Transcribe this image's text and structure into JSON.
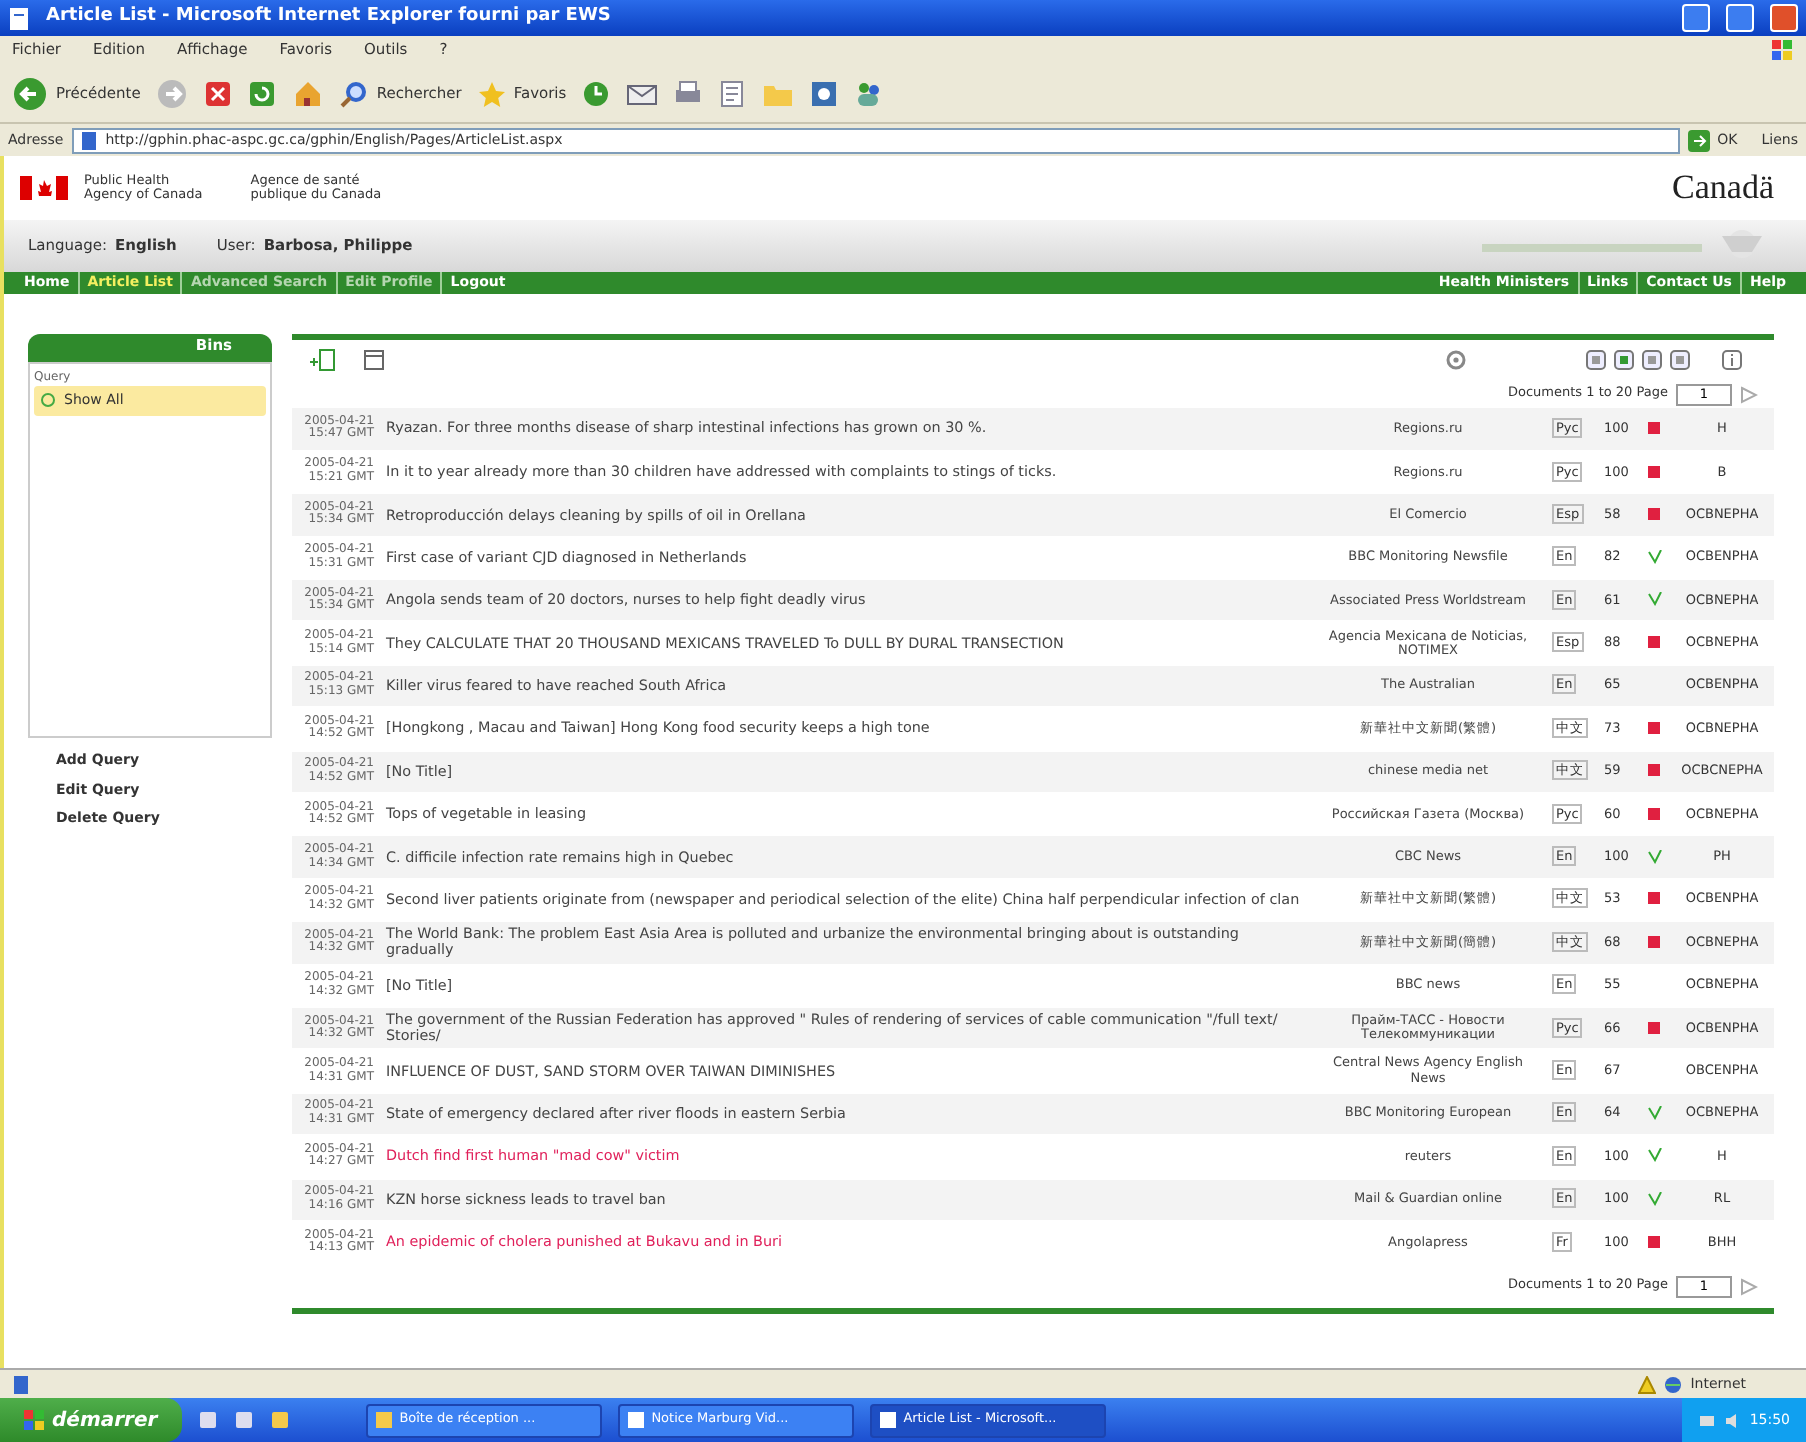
{
  "window": {
    "title": "Article List - Microsoft Internet Explorer fourni par EWS"
  },
  "menu": [
    "Fichier",
    "Edition",
    "Affichage",
    "Favoris",
    "Outils",
    "?"
  ],
  "toolbar": {
    "back": "Précédente",
    "search": "Rechercher",
    "favorites": "Favoris"
  },
  "address": {
    "label": "Adresse",
    "url": "http://gphin.phac-aspc.gc.ca/gphin/English/Pages/ArticleList.aspx",
    "go": "OK",
    "links": "Liens"
  },
  "agency": {
    "en_1": "Public Health",
    "en_2": "Agency of Canada",
    "fr_1": "Agence de santé",
    "fr_2": "publique du Canada",
    "wordmark": "Canadä"
  },
  "user_bar": {
    "language_label": "Language:",
    "language": "English",
    "user_label": "User:",
    "user": "Barbosa, Philippe"
  },
  "nav_left": [
    {
      "label": "Home",
      "selected": false
    },
    {
      "label": "Article List",
      "selected": true
    },
    {
      "label": "Advanced Search",
      "selected": false
    },
    {
      "label": "Edit Profile",
      "selected": false
    },
    {
      "label": "Logout",
      "selected": false
    }
  ],
  "nav_right": [
    "Health Ministers",
    "Links",
    "Contact Us",
    "Help"
  ],
  "sidebar": {
    "title": "Bins",
    "query_label": "Query",
    "items": [
      {
        "label": "Show All",
        "selected": true
      }
    ],
    "actions": [
      "Add Query",
      "Edit Query",
      "Delete Query"
    ]
  },
  "pager_top": {
    "label": "Documents 1 to 20 Page",
    "value": "1"
  },
  "rows": [
    {
      "date": "2005-04-21",
      "time": "15:47 GMT",
      "title": "Ryazan. For three months disease of sharp intestinal infections has grown on 30 %.",
      "flagged": false,
      "source": "Regions.ru",
      "lang": "Рус",
      "score": "100",
      "checked": false,
      "rejected": true,
      "code": "H"
    },
    {
      "date": "2005-04-21",
      "time": "15:21 GMT",
      "title": "In it to year already more than 30 children have addressed with complaints to stings of ticks.",
      "flagged": false,
      "source": "Regions.ru",
      "lang": "Рус",
      "score": "100",
      "checked": false,
      "rejected": true,
      "code": "B"
    },
    {
      "date": "2005-04-21",
      "time": "15:34 GMT",
      "title": "Retroproducción delays cleaning by spills of oil in Orellana",
      "flagged": false,
      "source": "El Comercio",
      "lang": "Esp",
      "score": "58",
      "checked": false,
      "rejected": true,
      "code": "OCBNEPHA"
    },
    {
      "date": "2005-04-21",
      "time": "15:31 GMT",
      "title": "First case of variant CJD diagnosed in Netherlands",
      "flagged": false,
      "source": "BBC Monitoring Newsfile",
      "lang": "En",
      "score": "82",
      "checked": true,
      "rejected": false,
      "code": "OCBENPHA"
    },
    {
      "date": "2005-04-21",
      "time": "15:34 GMT",
      "title": "Angola sends team of 20 doctors, nurses to help fight deadly virus",
      "flagged": false,
      "source": "Associated Press Worldstream",
      "lang": "En",
      "score": "61",
      "checked": true,
      "rejected": false,
      "code": "OCBNEPHA"
    },
    {
      "date": "2005-04-21",
      "time": "15:14 GMT",
      "title": "They CALCULATE THAT 20 THOUSAND MEXICANS TRAVELED To DULL BY DURAL TRANSECTION",
      "flagged": false,
      "source": "Agencia Mexicana de Noticias, NOTIMEX",
      "lang": "Esp",
      "score": "88",
      "checked": false,
      "rejected": true,
      "code": "OCBNEPHA"
    },
    {
      "date": "2005-04-21",
      "time": "15:13 GMT",
      "title": "Killer virus feared to have reached South Africa",
      "flagged": false,
      "source": "The Australian",
      "lang": "En",
      "score": "65",
      "checked": false,
      "rejected": false,
      "code": "OCBENPHA"
    },
    {
      "date": "2005-04-21",
      "time": "14:52 GMT",
      "title": "[Hongkong , Macau and Taiwan] Hong Kong food security keeps a high tone",
      "flagged": false,
      "source": "新華社中文新聞(繁體)",
      "lang": "中文",
      "score": "73",
      "checked": false,
      "rejected": true,
      "code": "OCBNEPHA"
    },
    {
      "date": "2005-04-21",
      "time": "14:52 GMT",
      "title": "[No Title]",
      "flagged": false,
      "source": "chinese media net",
      "lang": "中文",
      "score": "59",
      "checked": false,
      "rejected": true,
      "code": "OCBCNEPHA"
    },
    {
      "date": "2005-04-21",
      "time": "14:52 GMT",
      "title": "Tops of vegetable in leasing",
      "flagged": false,
      "source": "Российская Газета (Москва)",
      "lang": "Рус",
      "score": "60",
      "checked": false,
      "rejected": true,
      "code": "OCBNEPHA"
    },
    {
      "date": "2005-04-21",
      "time": "14:34 GMT",
      "title": "C. difficile infection rate remains high in Quebec",
      "flagged": false,
      "source": "CBC News",
      "lang": "En",
      "score": "100",
      "checked": true,
      "rejected": false,
      "code": "PH"
    },
    {
      "date": "2005-04-21",
      "time": "14:32 GMT",
      "title": "Second liver patients originate from (newspaper and periodical selection of the elite) China half perpendicular infection of clan",
      "flagged": false,
      "source": "新華社中文新聞(繁體)",
      "lang": "中文",
      "score": "53",
      "checked": false,
      "rejected": true,
      "code": "OCBENPHA"
    },
    {
      "date": "2005-04-21",
      "time": "14:32 GMT",
      "title": "The World Bank: The problem East Asia Area is polluted and urbanize the environmental bringing about is outstanding gradually",
      "flagged": false,
      "source": "新華社中文新聞(簡體)",
      "lang": "中文",
      "score": "68",
      "checked": false,
      "rejected": true,
      "code": "OCBNEPHA"
    },
    {
      "date": "2005-04-21",
      "time": "14:32 GMT",
      "title": "[No Title]",
      "flagged": false,
      "source": "BBC news",
      "lang": "En",
      "score": "55",
      "checked": false,
      "rejected": false,
      "code": "OCBNEPHA"
    },
    {
      "date": "2005-04-21",
      "time": "14:32 GMT",
      "title": "The government of the Russian Federation has approved \" Rules of rendering of services of cable communication \"/full text/ Stories/",
      "flagged": false,
      "source": "Прайм-ТАСС - Новости Телекоммуникации",
      "lang": "Рус",
      "score": "66",
      "checked": false,
      "rejected": true,
      "code": "OCBENPHA"
    },
    {
      "date": "2005-04-21",
      "time": "14:31 GMT",
      "title": "INFLUENCE OF DUST, SAND STORM OVER TAIWAN DIMINISHES",
      "flagged": false,
      "source": "Central News Agency English News",
      "lang": "En",
      "score": "67",
      "checked": false,
      "rejected": false,
      "code": "OBCENPHA"
    },
    {
      "date": "2005-04-21",
      "time": "14:31 GMT",
      "title": "State of emergency declared after river floods in eastern Serbia",
      "flagged": false,
      "source": "BBC Monitoring European",
      "lang": "En",
      "score": "64",
      "checked": true,
      "rejected": false,
      "code": "OCBNEPHA"
    },
    {
      "date": "2005-04-21",
      "time": "14:27 GMT",
      "title": "Dutch find first human \"mad cow\" victim",
      "flagged": true,
      "source": "reuters",
      "lang": "En",
      "score": "100",
      "checked": true,
      "rejected": false,
      "code": "H"
    },
    {
      "date": "2005-04-21",
      "time": "14:16 GMT",
      "title": "KZN horse sickness leads to travel ban",
      "flagged": false,
      "source": "Mail & Guardian online",
      "lang": "En",
      "score": "100",
      "checked": true,
      "rejected": false,
      "code": "RL"
    },
    {
      "date": "2005-04-21",
      "time": "14:13 GMT",
      "title": "An epidemic of cholera punished at Bukavu and in Buri",
      "flagged": true,
      "source": "Angolapress",
      "lang": "Fr",
      "score": "100",
      "checked": false,
      "rejected": true,
      "code": "BHH"
    }
  ],
  "pager_bottom": {
    "label": "Documents 1 to 20 Page",
    "value": "1"
  },
  "status_bar": {
    "zone": "Internet"
  },
  "taskbar": {
    "start": "démarrer",
    "tasks": [
      {
        "label": "Boîte de réception ...",
        "selected": false
      },
      {
        "label": "Notice Marburg Vid...",
        "selected": false
      },
      {
        "label": "Article List - Microsoft...",
        "selected": true
      }
    ],
    "clock": "15:50"
  }
}
